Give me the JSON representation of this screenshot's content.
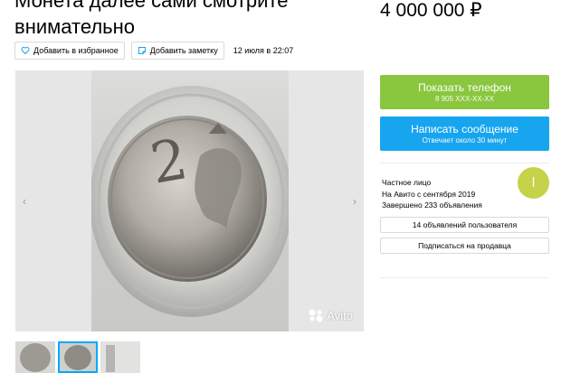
{
  "listing": {
    "title": "Монета далее сами смотрите\nвнимательно",
    "price": "4 000 000 ₽",
    "date": "12 июля в 22:07"
  },
  "actions": {
    "favorite_label": "Добавить в избранное",
    "note_label": "Добавить заметку"
  },
  "gallery": {
    "watermark": "Avito",
    "prev_icon": "chevron-left-icon",
    "next_icon": "chevron-right-icon",
    "thumbnail_count": 3,
    "active_thumbnail": 2
  },
  "contact": {
    "phone_label": "Показать телефон",
    "phone_number": "8 905 XXX-XX-XX",
    "message_label": "Написать сообщение",
    "message_note": "Отвечает около 30 минут"
  },
  "seller": {
    "type": "Частное лицо",
    "since": "На Авито с сентября 2019",
    "completed": "Завершено 233 объявления",
    "avatar_letter": "l",
    "listings_button": "14 объявлений пользователя",
    "subscribe_button": "Подписаться на продавца"
  },
  "colors": {
    "green": "#8ac63e",
    "blue": "#17a5f0",
    "avatar": "#c5d24a"
  }
}
